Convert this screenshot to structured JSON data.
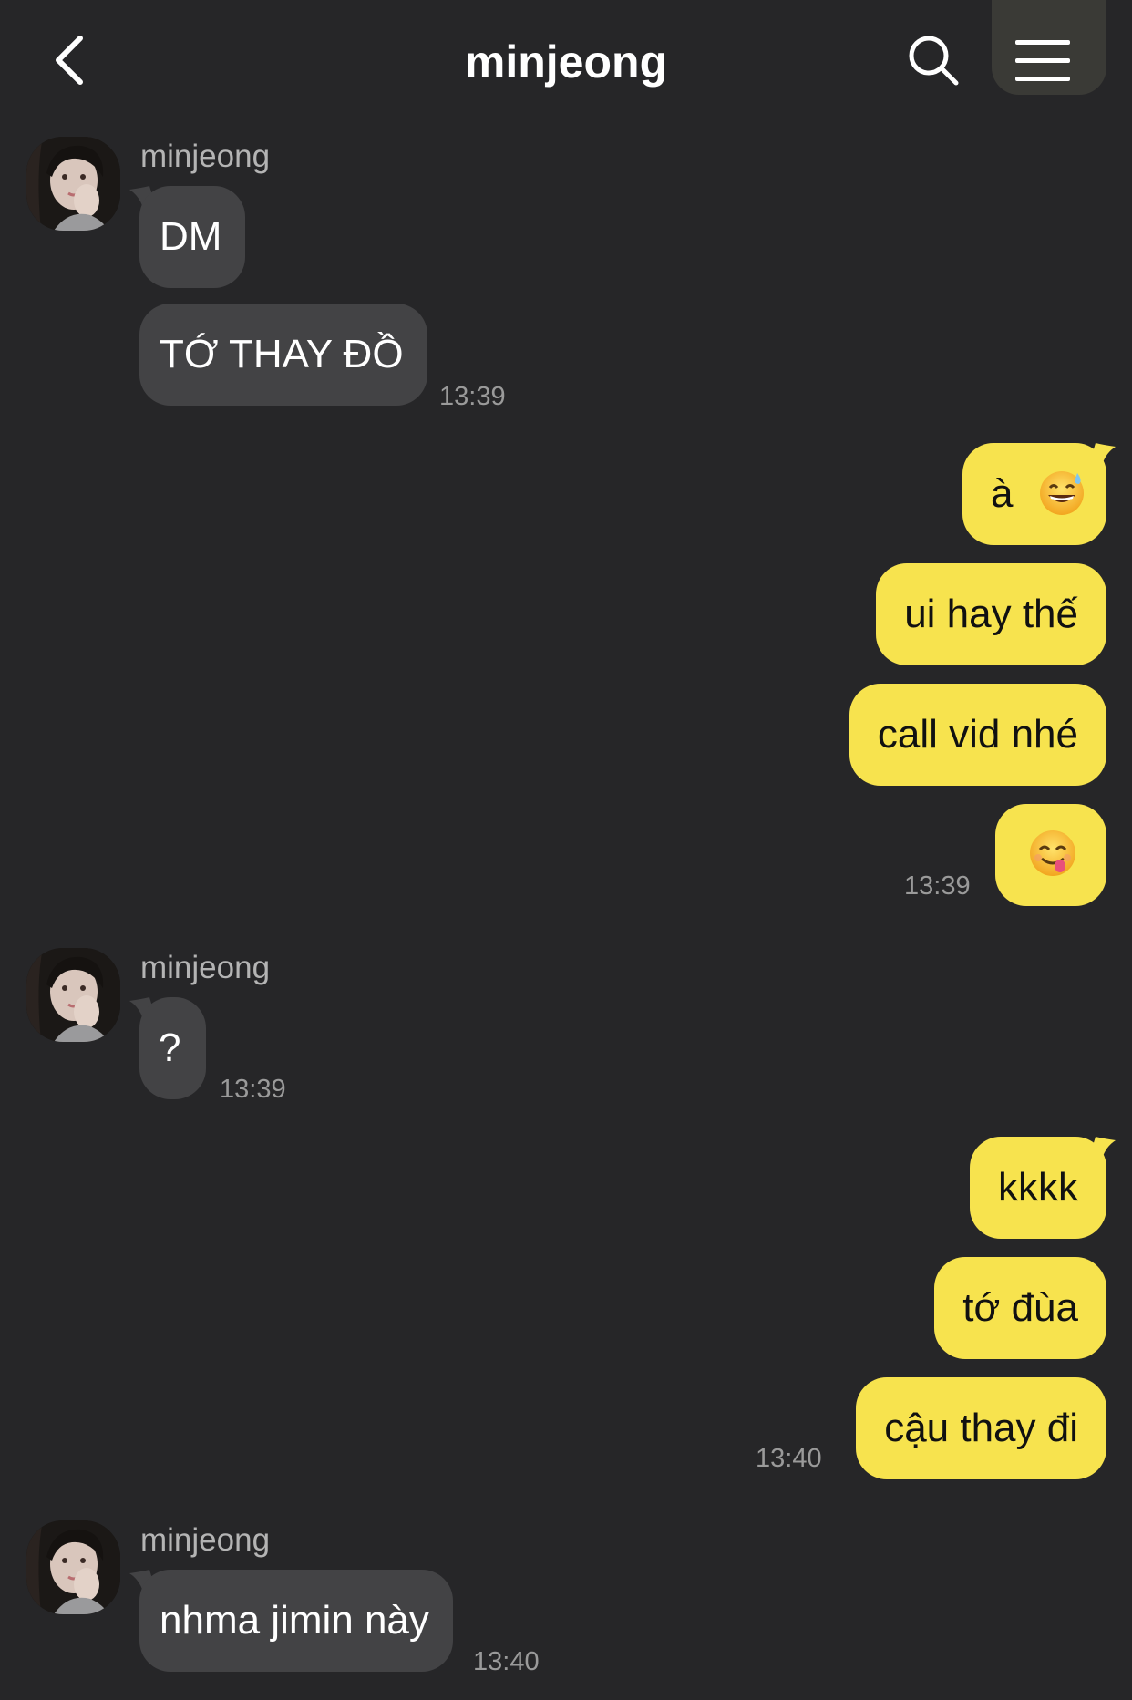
{
  "header": {
    "title": "minjeong",
    "back_icon": "chevron-left-icon",
    "search_icon": "search-icon",
    "menu_icon": "hamburger-menu-icon"
  },
  "colors": {
    "background": "#262628",
    "incoming_bubble": "#434345",
    "outgoing_bubble": "#f7e34e"
  },
  "messages": {
    "g1": {
      "sender": "minjeong",
      "m1": "DM",
      "m2": "TỚ THAY ĐỒ",
      "time": "13:39"
    },
    "g2": {
      "m1_text": "à",
      "m1_emoji": "grinning-sweat-emoji",
      "m2": "ui hay thế",
      "m3": "call vid nhé",
      "m4_emoji": "yum-face-emoji",
      "time": "13:39"
    },
    "g3": {
      "sender": "minjeong",
      "m1": "?",
      "time": "13:39"
    },
    "g4": {
      "m1": "kkkk",
      "m2": "tớ đùa",
      "m3": "cậu thay đi",
      "time": "13:40"
    },
    "g5": {
      "sender": "minjeong",
      "m1": "nhma jimin này",
      "time": "13:40"
    }
  }
}
